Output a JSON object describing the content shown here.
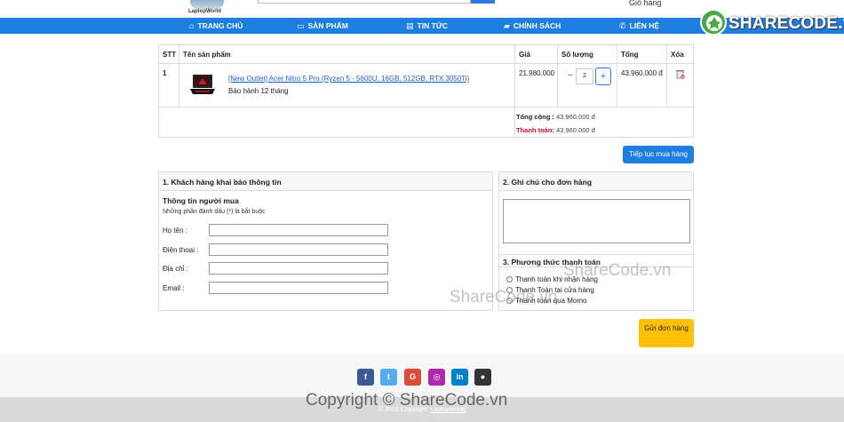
{
  "header": {
    "logo_text": "LaptopWorld",
    "cart_link": "Giỏ hàng"
  },
  "nav": {
    "items": [
      {
        "label": "TRANG CHỦ",
        "icon": "home-icon"
      },
      {
        "label": "SẢN PHẨM",
        "icon": "laptop-icon"
      },
      {
        "label": "TIN TỨC",
        "icon": "newspaper-icon"
      },
      {
        "label": "CHÍNH SÁCH",
        "icon": "truck-icon"
      },
      {
        "label": "LIÊN HỆ",
        "icon": "phone-icon"
      }
    ]
  },
  "badge": {
    "text": "SHARECODE.vn"
  },
  "cart": {
    "headers": {
      "stt": "STT",
      "name": "Tên sản phẩm",
      "price": "Giá",
      "qty": "Số lượng",
      "total": "Tổng",
      "delete": "Xóa"
    },
    "rows": [
      {
        "stt": "1",
        "name": "[New Outlet] Acer Nitro 5 Pro (Ryzen 5 - 5600U, 16GB, 512GB, RTX 3050Ti)",
        "warranty": "Bảo hành 12 tháng",
        "price": "21.980.000",
        "qty": "2",
        "minus": "−",
        "plus": "+",
        "total": "43.960.000 đ"
      }
    ],
    "summary_total_label": "Tổng cộng :",
    "summary_total_value": "43.960.000 đ",
    "summary_pay_label": "Thanh toán:",
    "summary_pay_value": "43.960.000 đ"
  },
  "continue_button": "Tiếp tục mua hàng",
  "customer": {
    "title": "1. Khách hàng khai báo thông tin",
    "subtitle": "Thông tin người mua",
    "note": "Những phần đánh dấu (*) là bắt buộc",
    "fields": [
      {
        "label": "Họ tên :",
        "value": ""
      },
      {
        "label": "Điện thoại :",
        "value": ""
      },
      {
        "label": "Địa chỉ :",
        "value": ""
      },
      {
        "label": "Email :",
        "value": ""
      }
    ]
  },
  "order_note": {
    "title": "2. Ghi chú cho đơn hàng",
    "value": ""
  },
  "payment": {
    "title": "3. Phương thức thanh toán",
    "options": [
      "Thanh toán khi nhận hàng",
      "Thanh Toán tại cửa hàng",
      "Thanh toán qua Momo"
    ]
  },
  "submit_button": "Gửi đơn hàng",
  "footer": {
    "socials": [
      {
        "icon": "facebook-icon",
        "glyph": "f",
        "color": "#3b5998"
      },
      {
        "icon": "twitter-icon",
        "glyph": "t",
        "color": "#55acee"
      },
      {
        "icon": "google-icon",
        "glyph": "G",
        "color": "#dd4b39"
      },
      {
        "icon": "instagram-icon",
        "glyph": "◎",
        "color": "#ac2bac"
      },
      {
        "icon": "linkedin-icon",
        "glyph": "in",
        "color": "#0082ca"
      },
      {
        "icon": "github-icon",
        "glyph": "●",
        "color": "#333333"
      }
    ],
    "copyright": "© 2023 Copyright:",
    "copyright_link": "LaptopWorld"
  },
  "watermarks": {
    "mid_right": "ShareCode.vn",
    "mid_left": "ShareCode.vn",
    "bottom": "Copyright © ShareCode.vn"
  }
}
